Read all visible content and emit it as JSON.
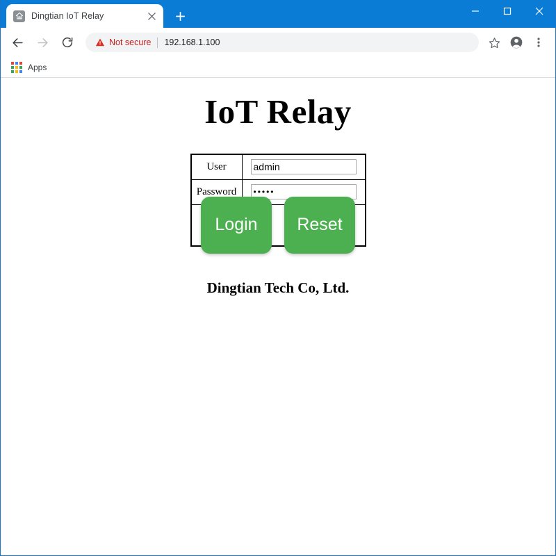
{
  "browser": {
    "tab": {
      "title": "Dingtian IoT Relay",
      "favicon_icon": "home-icon",
      "close_icon": "close-icon"
    },
    "new_tab_icon": "plus-icon",
    "window_controls": {
      "minimize_icon": "minimize-icon",
      "maximize_icon": "maximize-icon",
      "close_icon": "close-icon"
    },
    "toolbar": {
      "back_icon": "back-arrow-icon",
      "forward_icon": "forward-arrow-icon",
      "reload_icon": "reload-icon",
      "bookmark_icon": "star-icon",
      "profile_icon": "account-icon",
      "menu_icon": "three-dot-menu-icon"
    },
    "omnibox": {
      "security_icon": "warning-triangle-icon",
      "security_label": "Not secure",
      "url": "192.168.1.100"
    },
    "bookmarks_bar": {
      "apps_icon": "apps-grid-icon",
      "apps_label": "Apps"
    },
    "colors": {
      "titlebar_blue": "#0b7cd6",
      "not_secure_red": "#c5221f",
      "omnibox_gray": "#f1f3f4"
    }
  },
  "page": {
    "title": "IoT Relay",
    "form": {
      "rows": [
        {
          "label": "User",
          "value": "admin",
          "type": "text"
        },
        {
          "label": "Password",
          "value": "•••••",
          "type": "password"
        }
      ],
      "user_label": "User",
      "user_value": "admin",
      "password_label": "Password",
      "password_value": "•••••",
      "login_label": "Login",
      "reset_label": "Reset"
    },
    "footer": "Dingtian Tech Co, Ltd.",
    "colors": {
      "button_green": "#4caf50",
      "table_border": "#000000"
    }
  }
}
